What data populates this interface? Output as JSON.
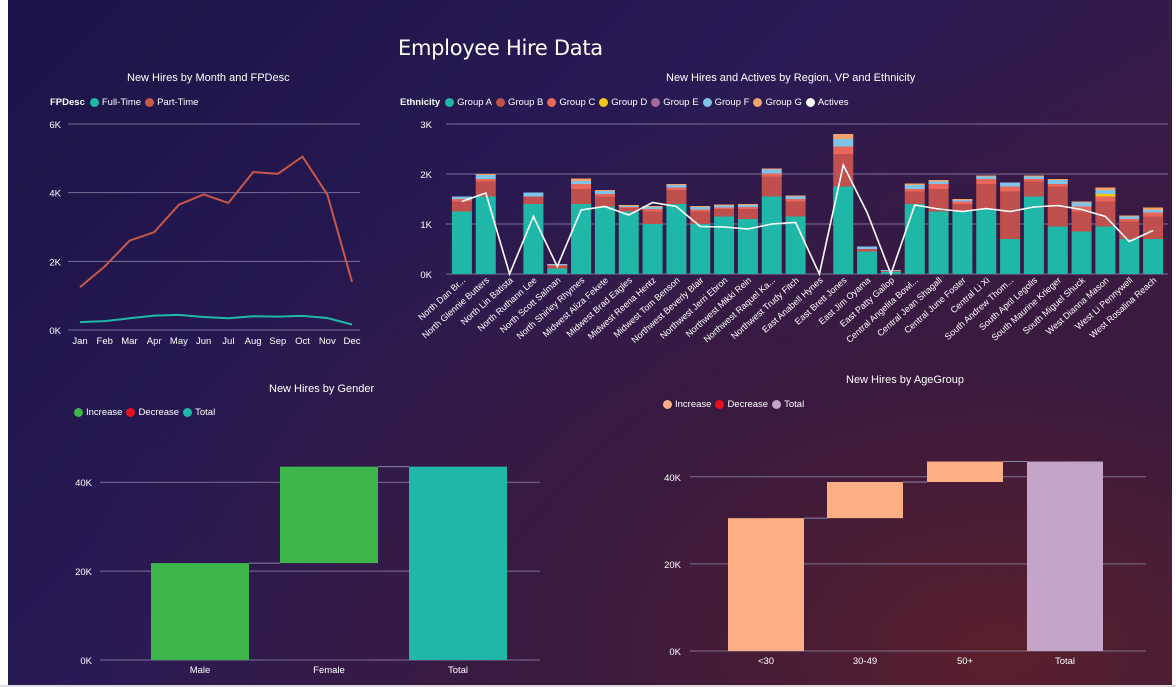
{
  "page_title": "Employee Hire Data",
  "colors": {
    "full_time": "#1fb8a8",
    "part_time": "#c8584a",
    "groupA": "#1fb8a8",
    "groupB": "#c0504d",
    "groupC": "#e8665a",
    "groupD": "#f2c811",
    "groupE": "#a66999",
    "groupF": "#7fc4e8",
    "groupG": "#f4a36c",
    "actives": "#ffffff",
    "gender_increase": "#3cb54a",
    "gender_decrease": "#e81123",
    "gender_total": "#1fb8a8",
    "age_increase": "#fcae85",
    "age_decrease": "#e81123",
    "age_total": "#c4a4c8"
  },
  "charts": {
    "month": {
      "title": "New Hires by Month and FPDesc",
      "legend_head": "FPDesc",
      "legend": [
        "Full-Time",
        "Part-Time"
      ]
    },
    "region": {
      "title": "New Hires and Actives by Region, VP and Ethnicity",
      "legend_head": "Ethnicity",
      "legend": [
        "Group A",
        "Group B",
        "Group C",
        "Group D",
        "Group E",
        "Group F",
        "Group G",
        "Actives"
      ]
    },
    "gender": {
      "title": "New Hires by Gender",
      "legend": [
        "Increase",
        "Decrease",
        "Total"
      ]
    },
    "age": {
      "title": "New Hires by AgeGroup",
      "legend": [
        "Increase",
        "Decrease",
        "Total"
      ]
    }
  },
  "chart_data": [
    {
      "type": "line",
      "title": "New Hires by Month and FPDesc",
      "categories": [
        "Jan",
        "Feb",
        "Mar",
        "Apr",
        "May",
        "Jun",
        "Jul",
        "Aug",
        "Sep",
        "Oct",
        "Nov",
        "Dec"
      ],
      "y_ticks": [
        "0K",
        "2K",
        "4K",
        "6K"
      ],
      "ylim": [
        0,
        6000
      ],
      "series": [
        {
          "name": "Full-Time",
          "values": [
            230,
            260,
            340,
            420,
            440,
            380,
            340,
            400,
            390,
            410,
            350,
            160
          ]
        },
        {
          "name": "Part-Time",
          "values": [
            1250,
            1850,
            2600,
            2850,
            3650,
            3950,
            3700,
            4600,
            4550,
            5050,
            3950,
            1400
          ]
        }
      ]
    },
    {
      "type": "bar",
      "stacked": true,
      "title": "New Hires and Actives by Region, VP and Ethnicity",
      "y_ticks": [
        "0K",
        "1K",
        "2K",
        "3K"
      ],
      "ylim": [
        0,
        3000
      ],
      "categories": [
        "North Dan Br...",
        "North Glennie Butters",
        "North Lin Batista",
        "North Ruthann Lee",
        "North Scott Salman",
        "North Shirley Rhymes",
        "Midwest Aliza Fekete",
        "Midwest Brad Eagles",
        "Midwest Reena Hentz",
        "Midwest Tom Benson",
        "Northwest Beverly Blair",
        "Northwest Jerri Ebron",
        "Northwest Mikki Rein",
        "Northwest Raquel Ka...",
        "Northwest Trudy Fitch",
        "East Anabell Hynes",
        "East Brett Jones",
        "East Jim Oyama",
        "East Patty Gallop",
        "Central Angelita Bowl...",
        "Central Jean Shagall",
        "Central June Foster",
        "Central Li Xi",
        "South Andrew Thom...",
        "South April Legolis",
        "South Maurine Krieger",
        "South Miguel Shuck",
        "West Dianna Mason",
        "West Li Pennywell",
        "West Rosalina Reach"
      ],
      "series": [
        {
          "name": "Group A",
          "values": [
            1250,
            1550,
            0,
            1400,
            110,
            1400,
            1350,
            1250,
            1000,
            1400,
            1000,
            1150,
            1100,
            1550,
            1150,
            0,
            1750,
            450,
            40,
            1400,
            1250,
            1250,
            1300,
            700,
            1550,
            950,
            850,
            950,
            700,
            700
          ]
        },
        {
          "name": "Group B",
          "values": [
            200,
            300,
            0,
            150,
            50,
            300,
            200,
            70,
            250,
            280,
            250,
            150,
            200,
            400,
            300,
            0,
            650,
            50,
            20,
            250,
            450,
            150,
            500,
            950,
            300,
            800,
            400,
            500,
            350,
            450
          ]
        },
        {
          "name": "Group C",
          "values": [
            50,
            50,
            0,
            0,
            20,
            100,
            50,
            20,
            50,
            50,
            40,
            30,
            40,
            60,
            50,
            0,
            150,
            0,
            0,
            50,
            100,
            50,
            100,
            100,
            50,
            50,
            100,
            100,
            50,
            80
          ]
        },
        {
          "name": "Group D",
          "values": [
            0,
            0,
            0,
            0,
            0,
            0,
            0,
            0,
            0,
            0,
            0,
            0,
            0,
            0,
            0,
            0,
            0,
            0,
            0,
            0,
            0,
            0,
            0,
            0,
            0,
            0,
            0,
            50,
            0,
            0
          ]
        },
        {
          "name": "Group E",
          "values": [
            0,
            0,
            0,
            0,
            0,
            0,
            0,
            0,
            0,
            0,
            0,
            0,
            0,
            0,
            0,
            0,
            0,
            0,
            0,
            0,
            0,
            0,
            0,
            0,
            0,
            0,
            0,
            0,
            0,
            0
          ]
        },
        {
          "name": "Group F",
          "values": [
            50,
            80,
            0,
            80,
            20,
            60,
            60,
            20,
            40,
            50,
            50,
            40,
            40,
            80,
            50,
            0,
            150,
            50,
            20,
            80,
            50,
            30,
            50,
            80,
            50,
            80,
            80,
            80,
            50,
            50
          ]
        },
        {
          "name": "Group G",
          "values": [
            0,
            20,
            0,
            0,
            0,
            50,
            20,
            20,
            20,
            20,
            20,
            20,
            20,
            20,
            20,
            0,
            100,
            0,
            0,
            30,
            30,
            20,
            20,
            0,
            20,
            20,
            20,
            50,
            20,
            50
          ]
        },
        {
          "name": "Actives",
          "line": true,
          "values": [
            1450,
            1620,
            0,
            1150,
            150,
            1280,
            1350,
            1180,
            1430,
            1350,
            950,
            940,
            900,
            1000,
            1030,
            0,
            2180,
            1230,
            0,
            1380,
            1300,
            1250,
            1310,
            1250,
            1340,
            1370,
            1290,
            1150,
            650,
            870
          ]
        }
      ]
    },
    {
      "type": "waterfall",
      "title": "New Hires by Gender",
      "categories": [
        "Male",
        "Female",
        "Total"
      ],
      "y_ticks": [
        "0K",
        "20K",
        "40K"
      ],
      "ylim": [
        0,
        45000
      ],
      "steps": [
        {
          "label": "Male",
          "kind": "increase",
          "start": 0,
          "end": 21800
        },
        {
          "label": "Female",
          "kind": "increase",
          "start": 21800,
          "end": 43500
        },
        {
          "label": "Total",
          "kind": "total",
          "start": 0,
          "end": 43500
        }
      ]
    },
    {
      "type": "waterfall",
      "title": "New Hires by AgeGroup",
      "categories": [
        "<30",
        "30-49",
        "50+",
        "Total"
      ],
      "y_ticks": [
        "0K",
        "20K",
        "40K"
      ],
      "ylim": [
        0,
        45000
      ],
      "steps": [
        {
          "label": "<30",
          "kind": "increase",
          "start": 0,
          "end": 30500
        },
        {
          "label": "30-49",
          "kind": "increase",
          "start": 30500,
          "end": 38800
        },
        {
          "label": "50+",
          "kind": "increase",
          "start": 38800,
          "end": 43500
        },
        {
          "label": "Total",
          "kind": "total",
          "start": 0,
          "end": 43500
        }
      ]
    }
  ]
}
